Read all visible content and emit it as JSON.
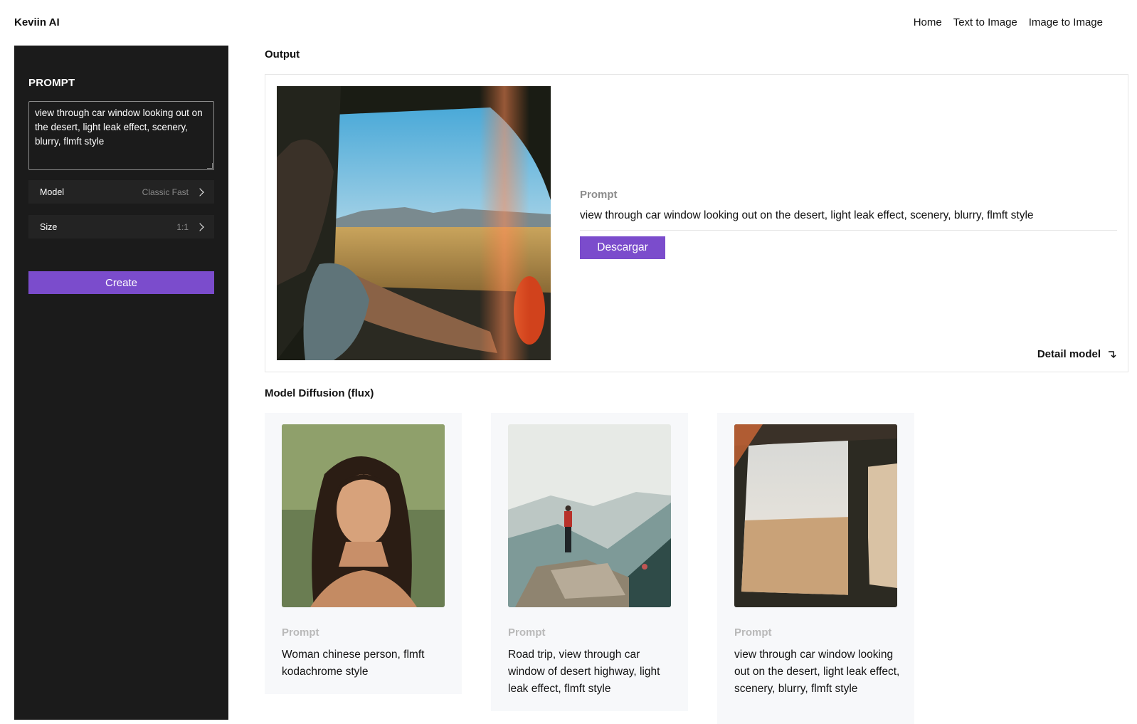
{
  "app": {
    "brand": "Keviin AI"
  },
  "nav": {
    "home": "Home",
    "text_to_image": "Text to Image",
    "image_to_image": "Image to Image"
  },
  "sidebar": {
    "title": "PROMPT",
    "prompt_value": "view through car window looking out on the desert, light leak effect, scenery, blurry, flmft style",
    "model": {
      "label": "Model",
      "value": "Classic Fast"
    },
    "size": {
      "label": "Size",
      "value": "1:1"
    },
    "create_label": "Create"
  },
  "output": {
    "title": "Output",
    "prompt_label": "Prompt",
    "prompt": "view through car window looking out on the desert, light leak effect, scenery, blurry, flmft style",
    "download_label": "Descargar",
    "detail_label": "Detail model"
  },
  "gallery": {
    "title": "Model Diffusion (flux)",
    "items": [
      {
        "prompt_label": "Prompt",
        "prompt": "Woman chinese person, flmft kodachrome style"
      },
      {
        "prompt_label": "Prompt",
        "prompt": "Road trip, view through car window of desert highway, light leak effect, flmft style"
      },
      {
        "prompt_label": "Prompt",
        "prompt": "view through car window looking out on the desert, light leak effect, scenery, blurry, flmft style"
      }
    ]
  },
  "colors": {
    "accent": "#7b4ccc",
    "sidebar_bg": "#1b1b1b",
    "card_bg": "#f7f8fa"
  }
}
